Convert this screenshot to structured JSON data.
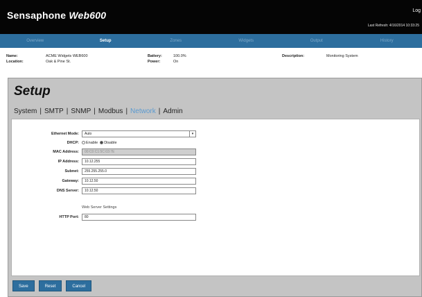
{
  "header": {
    "brand_prefix": "Sensaphone",
    "brand_model": "Web600",
    "logout_label": "Log",
    "last_refresh": "Last Refresh: 4/16/2014 10:33:25"
  },
  "nav": {
    "tabs": [
      {
        "label": "Overview"
      },
      {
        "label": "Setup"
      },
      {
        "label": "Zones"
      },
      {
        "label": "Widgets"
      },
      {
        "label": "Output"
      },
      {
        "label": "History"
      }
    ]
  },
  "info": {
    "name_label": "Name:",
    "name_value": "ACME Widgets WEB600",
    "location_label": "Location:",
    "location_value": "Oak & Pine St.",
    "battery_label": "Battery:",
    "battery_value": "100.0%",
    "power_label": "Power:",
    "power_value": "On",
    "description_label": "Description:",
    "description_value": "Monitoring System"
  },
  "setup": {
    "title": "Setup",
    "subnav": [
      "System",
      "SMTP",
      "SNMP",
      "Modbus",
      "Network",
      "Admin"
    ],
    "active_subnav": "Network"
  },
  "form": {
    "ethernet_mode_label": "Ethernet Mode:",
    "ethernet_mode_value": "Auto",
    "dhcp_label": "DHCP:",
    "dhcp_enable": "Enable",
    "dhcp_disable": "Disable",
    "mac_label": "MAC Address:",
    "mac_value": "00:C0:C1:5C:03:7E",
    "ip_label": "IP Address:",
    "ip_value": "10.12.255",
    "subnet_label": "Subnet:",
    "subnet_value": "255.255.255.0",
    "gateway_label": "Gateway:",
    "gateway_value": "10.12.50",
    "dns_label": "DNS Server:",
    "dns_value": "10.12.50",
    "web_section_label": "Web Server Settings",
    "http_label": "HTTP Port:",
    "http_value": "80"
  },
  "buttons": {
    "save": "Save",
    "reset": "Reset",
    "cancel": "Cancel"
  },
  "colors": {
    "nav_bg": "#2d6e9e",
    "header_bg": "#050505",
    "panel_bg": "#c4c4c4",
    "active_link": "#5a9ad0"
  }
}
